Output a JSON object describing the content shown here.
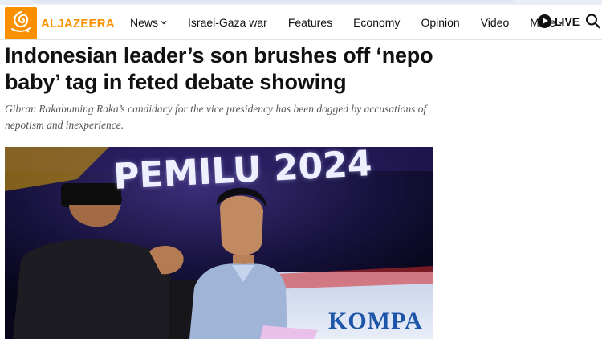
{
  "site": {
    "logo_text": "ALJAZEERA",
    "brand_color": "#fa9000"
  },
  "nav": {
    "items": [
      {
        "label": "News",
        "has_dropdown": true
      },
      {
        "label": "Israel-Gaza war",
        "has_dropdown": false
      },
      {
        "label": "Features",
        "has_dropdown": false
      },
      {
        "label": "Economy",
        "has_dropdown": false
      },
      {
        "label": "Opinion",
        "has_dropdown": false
      },
      {
        "label": "Video",
        "has_dropdown": false
      },
      {
        "label": "More",
        "has_dropdown": true
      }
    ],
    "live_label": "LIVE",
    "search_icon": "search-icon"
  },
  "article": {
    "headline": "Indonesian leader’s son brushes off ‘nepo baby’ tag in feted debate showing",
    "subhead": "Gibran Rakabuming Raka’s candidacy for the vice presidency has been dogged by accusations of nepotism and inexperience.",
    "image": {
      "backdrop_text": "PEMILU 2024",
      "banner_text": "KOMPA"
    }
  }
}
